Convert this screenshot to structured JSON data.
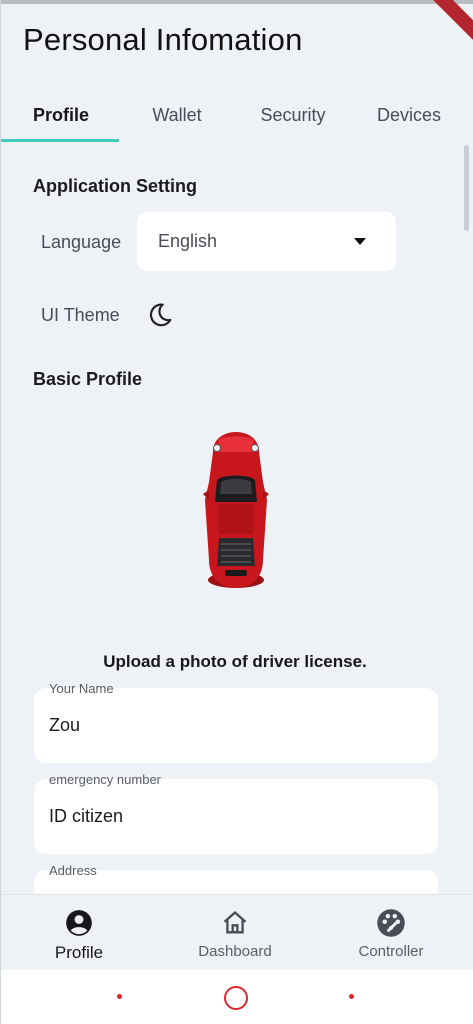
{
  "page": {
    "title": "Personal Infomation"
  },
  "tabs": [
    {
      "label": "Profile",
      "active": true
    },
    {
      "label": "Wallet",
      "active": false
    },
    {
      "label": "Security",
      "active": false
    },
    {
      "label": "Devices",
      "active": false
    }
  ],
  "application_setting": {
    "title": "Application Setting",
    "language_label": "Language",
    "language_value": "English",
    "theme_label": "UI Theme",
    "theme_icon": "moon-icon"
  },
  "basic_profile": {
    "title": "Basic Profile",
    "photo_icon": "red-sports-car-image",
    "upload_text": "Upload a photo of driver license.",
    "fields": [
      {
        "label": "Your Name",
        "value": "Zou"
      },
      {
        "label": "emergency number",
        "value": "ID citizen"
      },
      {
        "label": "Address",
        "value": ""
      }
    ]
  },
  "bottom_nav": [
    {
      "label": "Profile",
      "icon": "account-circle-icon",
      "active": true
    },
    {
      "label": "Dashboard",
      "icon": "home-icon",
      "active": false
    },
    {
      "label": "Controller",
      "icon": "palette-icon",
      "active": false
    }
  ],
  "colors": {
    "accent": "#3fcbbf",
    "background": "#eef1f6",
    "system_nav": "#e0252d",
    "car": "#c8161d"
  }
}
